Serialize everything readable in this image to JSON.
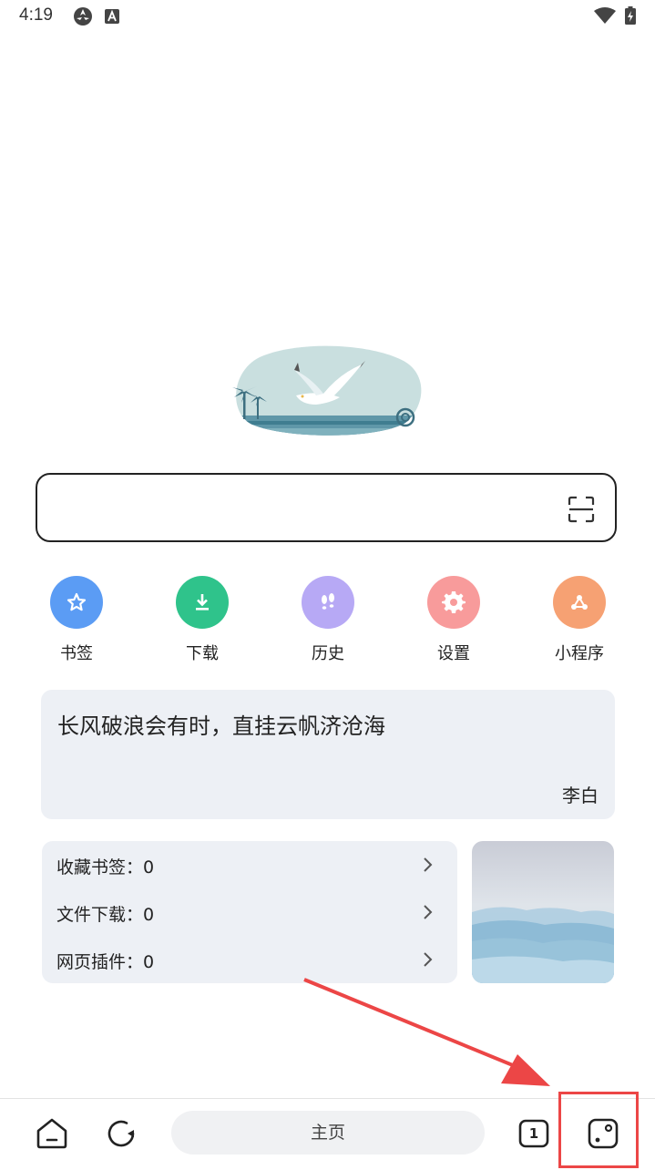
{
  "status_bar": {
    "time": "4:19"
  },
  "search": {
    "placeholder": ""
  },
  "shortcuts": [
    {
      "label": "书签",
      "icon": "star-icon",
      "color": "#5b9cf4"
    },
    {
      "label": "下载",
      "icon": "download-icon",
      "color": "#2fc38b"
    },
    {
      "label": "历史",
      "icon": "footprints-icon",
      "color": "#b7a9f5"
    },
    {
      "label": "设置",
      "icon": "gear-icon",
      "color": "#f89b9b"
    },
    {
      "label": "小程序",
      "icon": "mini-program-icon",
      "color": "#f6a173"
    }
  ],
  "quote": {
    "text": "长风破浪会有时，直挂云帆济沧海",
    "author": "李白"
  },
  "stats": [
    {
      "label": "收藏书签：0"
    },
    {
      "label": "文件下载：0"
    },
    {
      "label": "网页插件：0"
    }
  ],
  "bottom_bar": {
    "home_label": "主页",
    "tab_count": "1"
  },
  "colors": {
    "annotation": "#ec4646",
    "card_bg": "#edf0f5"
  }
}
